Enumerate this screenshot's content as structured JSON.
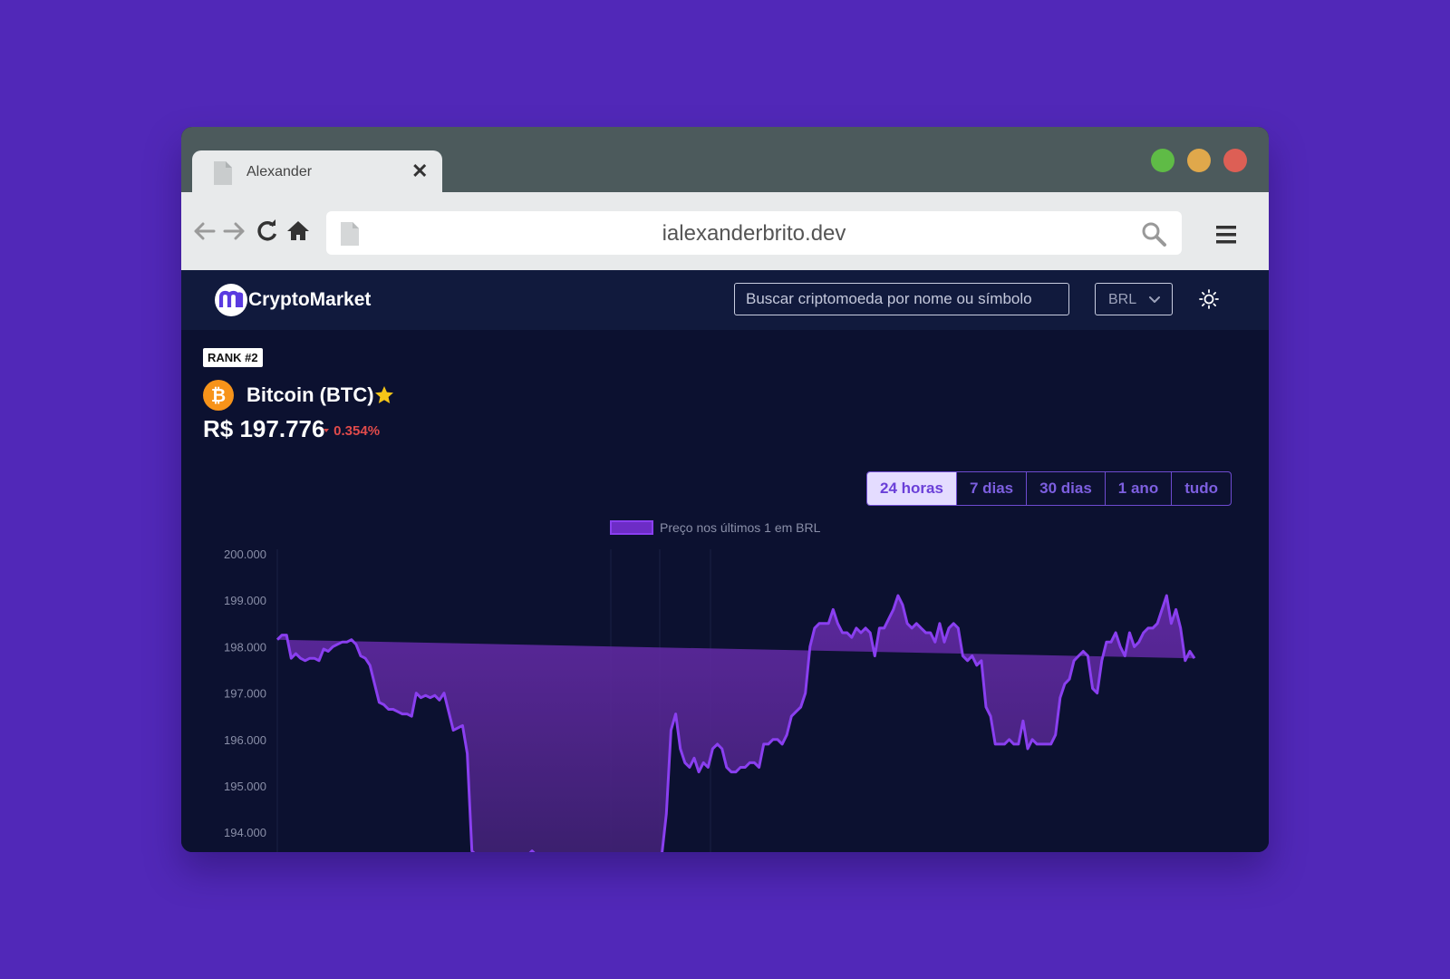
{
  "browser": {
    "tab_title": "Alexander",
    "tab_close": "✕",
    "address": "ialexanderbrito.dev"
  },
  "app": {
    "logo_text": "CryptoMarket",
    "search_placeholder": "Buscar criptomoeda por nome ou símbolo",
    "currency": "BRL"
  },
  "coin": {
    "rank": "RANK #2",
    "name": "Bitcoin (BTC)",
    "price": "R$ 197.776",
    "change": "0.354%",
    "change_direction": "down"
  },
  "ranges": [
    {
      "label": "24 horas",
      "active": true
    },
    {
      "label": "7 dias",
      "active": false
    },
    {
      "label": "30 dias",
      "active": false
    },
    {
      "label": "1 ano",
      "active": false
    },
    {
      "label": "tudo",
      "active": false
    }
  ],
  "colors": {
    "background": "#5128b8",
    "page_bg": "#0c1130",
    "accent": "#8a3ff0",
    "negative": "#e14b4b",
    "star": "#f5c518",
    "btc": "#f7931a"
  },
  "chart_data": {
    "type": "area",
    "legend": "Preço nos últimos 1 em BRL",
    "y_tick_labels": [
      "200.000",
      "199.000",
      "198.000",
      "197.000",
      "196.000",
      "195.000",
      "194.000"
    ],
    "ylim": [
      193700,
      200000
    ],
    "y_ticks": [
      200000,
      199000,
      198000,
      197000,
      196000,
      195000,
      194000
    ],
    "x": [
      0,
      1,
      2,
      3,
      4,
      5,
      6,
      7,
      8,
      9,
      10,
      11,
      12,
      13,
      14,
      15,
      16,
      17,
      18,
      19,
      20,
      21,
      22,
      23,
      24,
      25,
      26,
      27,
      28,
      29,
      30,
      31,
      32,
      33,
      34,
      35,
      36,
      37,
      38,
      39,
      40,
      41,
      42,
      43,
      44,
      45,
      46,
      47,
      48,
      49,
      50,
      51,
      52,
      53,
      54,
      55,
      56,
      57,
      58,
      59,
      60,
      61,
      62,
      63,
      64,
      65,
      66,
      67,
      68,
      69,
      70,
      71,
      72,
      73,
      74,
      75,
      76,
      77,
      78,
      79,
      80,
      81,
      82,
      83,
      84,
      85,
      86,
      87,
      88,
      89,
      90,
      91,
      92,
      93,
      94,
      95,
      96,
      97,
      98,
      99,
      100,
      101,
      102,
      103,
      104,
      105,
      106,
      107,
      108,
      109,
      110,
      111,
      112,
      113,
      114,
      115,
      116,
      117,
      118,
      119,
      120,
      121,
      122,
      123,
      124,
      125,
      126,
      127,
      128,
      129,
      130,
      131,
      132,
      133,
      134,
      135,
      136,
      137,
      138,
      139,
      140,
      141,
      142,
      143,
      144,
      145,
      146,
      147,
      148,
      149,
      150,
      151,
      152,
      153,
      154,
      155,
      156,
      157,
      158,
      159,
      160,
      161,
      162,
      163,
      164,
      165,
      166,
      167,
      168,
      169,
      170,
      171,
      172,
      173,
      174,
      175,
      176,
      177,
      178,
      179,
      180,
      181,
      182,
      183,
      184,
      185,
      186,
      187,
      188,
      189,
      190,
      191,
      192,
      193,
      194,
      195,
      196,
      197,
      198
    ],
    "series": [
      {
        "values": [
          198150,
          198250,
          198250,
          197750,
          197850,
          197750,
          197700,
          197750,
          197750,
          197700,
          197950,
          197900,
          198000,
          198050,
          198100,
          198100,
          198150,
          198050,
          197800,
          197750,
          197600,
          197200,
          196800,
          196750,
          196650,
          196650,
          196600,
          196550,
          196550,
          196500,
          197000,
          196900,
          196950,
          196900,
          196950,
          196850,
          197000,
          196600,
          196200,
          196250,
          196300,
          195700,
          193600,
          193500,
          193500,
          193400,
          193500,
          193500,
          193500,
          193400,
          193500,
          193500,
          193500,
          193500,
          193500,
          193600,
          193500,
          193500,
          193500,
          193500,
          193500,
          193500,
          193500,
          193500,
          193500,
          193500,
          193500,
          193500,
          193500,
          193500,
          193500,
          193500,
          193500,
          193500,
          193500,
          193500,
          193500,
          193500,
          193500,
          193500,
          193500,
          193500,
          193500,
          193500,
          194400,
          196200,
          196550,
          195800,
          195500,
          195400,
          195600,
          195300,
          195500,
          195400,
          195800,
          195900,
          195800,
          195400,
          195300,
          195300,
          195400,
          195400,
          195500,
          195500,
          195400,
          195900,
          195900,
          196000,
          196000,
          195900,
          196100,
          196500,
          196600,
          196700,
          197000,
          198000,
          198400,
          198500,
          198500,
          198500,
          198800,
          198500,
          198300,
          198300,
          198200,
          198400,
          198300,
          198400,
          198300,
          197800,
          198400,
          198400,
          198600,
          198800,
          199100,
          198900,
          198500,
          198400,
          198500,
          198400,
          198300,
          198300,
          198100,
          198500,
          198100,
          198400,
          198500,
          198400,
          197800,
          197700,
          197800,
          197600,
          197700,
          196700,
          196500,
          195900,
          195900,
          195900,
          196000,
          195900,
          195900,
          196400,
          195800,
          196000,
          195900,
          195900,
          195900,
          195900,
          196100,
          196900,
          197200,
          197300,
          197700,
          197800,
          197900,
          197800,
          197100,
          197000,
          197700,
          198100,
          198100,
          198300,
          198000,
          197800,
          198300,
          198000,
          198100,
          198300,
          198400,
          198400,
          198500,
          198800,
          199100,
          198500,
          198800,
          198400,
          197700,
          197900,
          197750,
          197750
        ]
      }
    ]
  }
}
